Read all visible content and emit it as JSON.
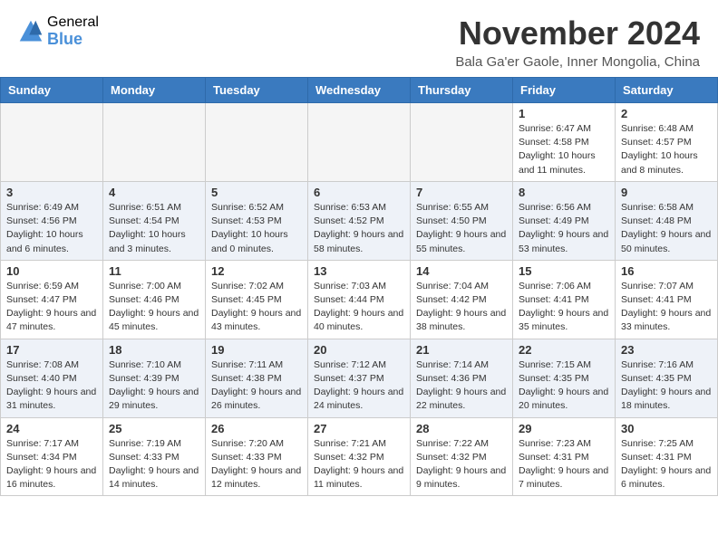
{
  "logo": {
    "general": "General",
    "blue": "Blue"
  },
  "title": "November 2024",
  "location": "Bala Ga'er Gaole, Inner Mongolia, China",
  "days_of_week": [
    "Sunday",
    "Monday",
    "Tuesday",
    "Wednesday",
    "Thursday",
    "Friday",
    "Saturday"
  ],
  "weeks": [
    [
      {
        "day": "",
        "info": ""
      },
      {
        "day": "",
        "info": ""
      },
      {
        "day": "",
        "info": ""
      },
      {
        "day": "",
        "info": ""
      },
      {
        "day": "",
        "info": ""
      },
      {
        "day": "1",
        "info": "Sunrise: 6:47 AM\nSunset: 4:58 PM\nDaylight: 10 hours and 11 minutes."
      },
      {
        "day": "2",
        "info": "Sunrise: 6:48 AM\nSunset: 4:57 PM\nDaylight: 10 hours and 8 minutes."
      }
    ],
    [
      {
        "day": "3",
        "info": "Sunrise: 6:49 AM\nSunset: 4:56 PM\nDaylight: 10 hours and 6 minutes."
      },
      {
        "day": "4",
        "info": "Sunrise: 6:51 AM\nSunset: 4:54 PM\nDaylight: 10 hours and 3 minutes."
      },
      {
        "day": "5",
        "info": "Sunrise: 6:52 AM\nSunset: 4:53 PM\nDaylight: 10 hours and 0 minutes."
      },
      {
        "day": "6",
        "info": "Sunrise: 6:53 AM\nSunset: 4:52 PM\nDaylight: 9 hours and 58 minutes."
      },
      {
        "day": "7",
        "info": "Sunrise: 6:55 AM\nSunset: 4:50 PM\nDaylight: 9 hours and 55 minutes."
      },
      {
        "day": "8",
        "info": "Sunrise: 6:56 AM\nSunset: 4:49 PM\nDaylight: 9 hours and 53 minutes."
      },
      {
        "day": "9",
        "info": "Sunrise: 6:58 AM\nSunset: 4:48 PM\nDaylight: 9 hours and 50 minutes."
      }
    ],
    [
      {
        "day": "10",
        "info": "Sunrise: 6:59 AM\nSunset: 4:47 PM\nDaylight: 9 hours and 47 minutes."
      },
      {
        "day": "11",
        "info": "Sunrise: 7:00 AM\nSunset: 4:46 PM\nDaylight: 9 hours and 45 minutes."
      },
      {
        "day": "12",
        "info": "Sunrise: 7:02 AM\nSunset: 4:45 PM\nDaylight: 9 hours and 43 minutes."
      },
      {
        "day": "13",
        "info": "Sunrise: 7:03 AM\nSunset: 4:44 PM\nDaylight: 9 hours and 40 minutes."
      },
      {
        "day": "14",
        "info": "Sunrise: 7:04 AM\nSunset: 4:42 PM\nDaylight: 9 hours and 38 minutes."
      },
      {
        "day": "15",
        "info": "Sunrise: 7:06 AM\nSunset: 4:41 PM\nDaylight: 9 hours and 35 minutes."
      },
      {
        "day": "16",
        "info": "Sunrise: 7:07 AM\nSunset: 4:41 PM\nDaylight: 9 hours and 33 minutes."
      }
    ],
    [
      {
        "day": "17",
        "info": "Sunrise: 7:08 AM\nSunset: 4:40 PM\nDaylight: 9 hours and 31 minutes."
      },
      {
        "day": "18",
        "info": "Sunrise: 7:10 AM\nSunset: 4:39 PM\nDaylight: 9 hours and 29 minutes."
      },
      {
        "day": "19",
        "info": "Sunrise: 7:11 AM\nSunset: 4:38 PM\nDaylight: 9 hours and 26 minutes."
      },
      {
        "day": "20",
        "info": "Sunrise: 7:12 AM\nSunset: 4:37 PM\nDaylight: 9 hours and 24 minutes."
      },
      {
        "day": "21",
        "info": "Sunrise: 7:14 AM\nSunset: 4:36 PM\nDaylight: 9 hours and 22 minutes."
      },
      {
        "day": "22",
        "info": "Sunrise: 7:15 AM\nSunset: 4:35 PM\nDaylight: 9 hours and 20 minutes."
      },
      {
        "day": "23",
        "info": "Sunrise: 7:16 AM\nSunset: 4:35 PM\nDaylight: 9 hours and 18 minutes."
      }
    ],
    [
      {
        "day": "24",
        "info": "Sunrise: 7:17 AM\nSunset: 4:34 PM\nDaylight: 9 hours and 16 minutes."
      },
      {
        "day": "25",
        "info": "Sunrise: 7:19 AM\nSunset: 4:33 PM\nDaylight: 9 hours and 14 minutes."
      },
      {
        "day": "26",
        "info": "Sunrise: 7:20 AM\nSunset: 4:33 PM\nDaylight: 9 hours and 12 minutes."
      },
      {
        "day": "27",
        "info": "Sunrise: 7:21 AM\nSunset: 4:32 PM\nDaylight: 9 hours and 11 minutes."
      },
      {
        "day": "28",
        "info": "Sunrise: 7:22 AM\nSunset: 4:32 PM\nDaylight: 9 hours and 9 minutes."
      },
      {
        "day": "29",
        "info": "Sunrise: 7:23 AM\nSunset: 4:31 PM\nDaylight: 9 hours and 7 minutes."
      },
      {
        "day": "30",
        "info": "Sunrise: 7:25 AM\nSunset: 4:31 PM\nDaylight: 9 hours and 6 minutes."
      }
    ]
  ]
}
